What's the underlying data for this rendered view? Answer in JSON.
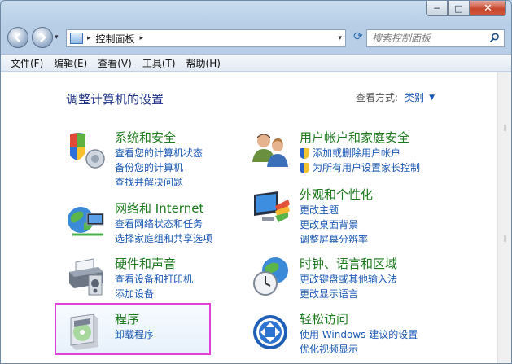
{
  "window": {
    "caption_buttons": {
      "minimize": "─",
      "maximize": "□",
      "close": "✕"
    }
  },
  "navigation": {
    "back_icon": "back-arrow-icon",
    "forward_icon": "forward-arrow-icon",
    "dropdown_glyph": "▾",
    "address": {
      "breadcrumb": "控制面板",
      "separator": "▸"
    },
    "refresh_glyph": "⟳",
    "search": {
      "placeholder": "搜索控制面板"
    }
  },
  "menubar": {
    "items": [
      "文件(F)",
      "编辑(E)",
      "查看(V)",
      "工具(T)",
      "帮助(H)"
    ]
  },
  "content": {
    "title": "调整计算机的设置",
    "view_by_label": "查看方式:",
    "view_by_value": "类别",
    "view_caret": "▼",
    "categories": [
      {
        "title": "系统和安全",
        "links": [
          "查看您的计算机状态",
          "备份您的计算机",
          "查找并解决问题"
        ],
        "icon": "security-shield-icon"
      },
      {
        "title": "用户帐户和家庭安全",
        "links": [
          "添加或删除用户帐户",
          "为所有用户设置家长控制"
        ],
        "icon": "users-icon",
        "shield_links": true
      },
      {
        "title": "网络和 Internet",
        "links": [
          "查看网络状态和任务",
          "选择家庭组和共享选项"
        ],
        "icon": "network-globe-icon"
      },
      {
        "title": "外观和个性化",
        "links": [
          "更改主题",
          "更改桌面背景",
          "调整屏幕分辨率"
        ],
        "icon": "monitor-palette-icon"
      },
      {
        "title": "硬件和声音",
        "links": [
          "查看设备和打印机",
          "添加设备"
        ],
        "icon": "printer-icon"
      },
      {
        "title": "时钟、语言和区域",
        "links": [
          "更改键盘或其他输入法",
          "更改显示语言"
        ],
        "icon": "clock-globe-icon"
      },
      {
        "title": "程序",
        "links": [
          "卸载程序"
        ],
        "icon": "programs-icon"
      },
      {
        "title": "轻松访问",
        "links": [
          "使用 Windows 建议的设置",
          "优化视频显示"
        ],
        "icon": "ease-of-access-icon"
      }
    ]
  },
  "colors": {
    "category_title": "#1c7a1c",
    "link": "#1a58b5",
    "page_title": "#1e3287",
    "highlight_border": "#e040d8"
  }
}
